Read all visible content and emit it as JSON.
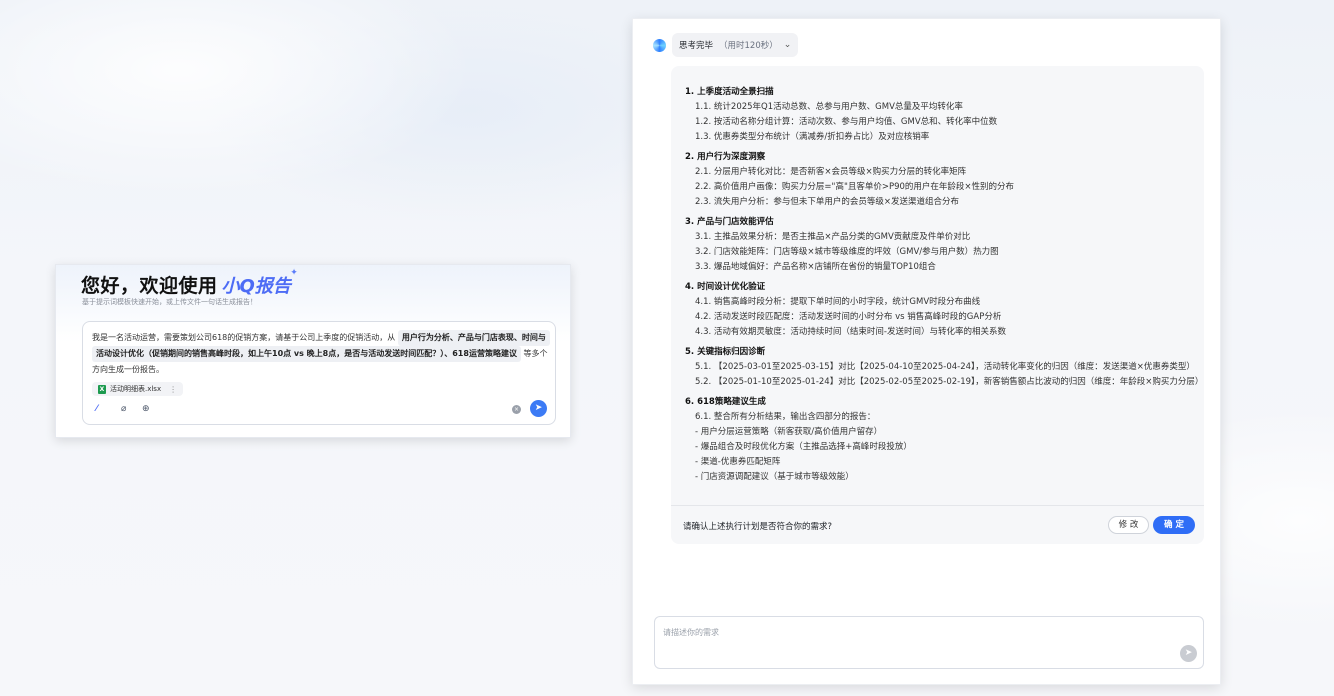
{
  "left": {
    "greeting": "您好，欢迎使用",
    "brand": "小Q报告",
    "subtitle": "基于提示词模板快速开始，或上传文件一句话生成报告！",
    "prompt_prefix": "我是一名活动运营，需要策划公司618的促销方案，请基于公司上季度的促销活动，从",
    "chip_1": "用户行为分析、产品与门店表现、时间与",
    "chip_2": "活动设计优化（促销期间的销售高峰时段，如上午10点 vs 晚上8点，是否与活动发送时间匹配？）、618运营策略建议",
    "prompt_suffix": "等多个方向生成一份报告。",
    "file_name": "活动明细表.xlsx",
    "file_icon_label": "X",
    "file_more": "⋮",
    "tool_1": "⁄",
    "tool_2": "⌀",
    "tool_3": "⊕",
    "clear": "×",
    "send": "➤"
  },
  "right": {
    "status": "思考完毕",
    "time": "（用时120秒）",
    "chevron": "⌄",
    "sections": [
      {
        "title": "1. 上季度活动全景扫描",
        "items": [
          "1.1. 统计2025年Q1活动总数、总参与用户数、GMV总量及平均转化率",
          "1.2. 按活动名称分组计算：活动次数、参与用户均值、GMV总和、转化率中位数",
          "1.3. 优惠券类型分布统计（满减券/折扣券占比）及对应核销率"
        ]
      },
      {
        "title": "2. 用户行为深度洞察",
        "items": [
          "2.1. 分层用户转化对比：是否新客×会员等级×购买力分层的转化率矩阵",
          "2.2. 高价值用户画像：购买力分层=\"高\"且客单价>P90的用户在年龄段×性别的分布",
          "2.3. 流失用户分析：参与但未下单用户的会员等级×发送渠道组合分布"
        ]
      },
      {
        "title": "3. 产品与门店效能评估",
        "items": [
          "3.1. 主推品效果分析：是否主推品×产品分类的GMV贡献度及件单价对比",
          "3.2. 门店效能矩阵：门店等级×城市等级维度的坪效（GMV/参与用户数）热力图",
          "3.3. 爆品地域偏好：产品名称×店铺所在省份的销量TOP10组合"
        ]
      },
      {
        "title": "4. 时间设计优化验证",
        "items": [
          "4.1. 销售高峰时段分析：提取下单时间的小时字段，统计GMV时段分布曲线",
          "4.2. 活动发送时段匹配度：活动发送时间的小时分布 vs 销售高峰时段的GAP分析",
          "4.3. 活动有效期灵敏度：活动持续时间（结束时间-发送时间）与转化率的相关系数"
        ]
      },
      {
        "title": "5. 关键指标归因诊断",
        "items": [
          "5.1. 【2025-03-01至2025-03-15】对比【2025-04-10至2025-04-24】，活动转化率变化的归因（维度：发送渠道×优惠券类型）",
          "5.2. 【2025-01-10至2025-01-24】对比【2025-02-05至2025-02-19】，新客销售额占比波动的归因（维度：年龄段×购买力分层）"
        ]
      },
      {
        "title": "6. 618策略建议生成",
        "items": [
          "6.1. 整合所有分析结果，输出含四部分的报告：",
          "- 用户分层运营策略（新客获取/高价值用户留存）",
          "- 爆品组合及时段优化方案（主推品选择+高峰时段投放）",
          "- 渠道-优惠券匹配矩阵",
          "- 门店资源调配建议（基于城市等级效能）"
        ]
      }
    ],
    "confirm_question": "请确认上述执行计划是否符合你的需求?",
    "edit_label": "修 改",
    "ok_label": "确 定",
    "input_placeholder": "请描述你的需求",
    "send": "➤"
  }
}
